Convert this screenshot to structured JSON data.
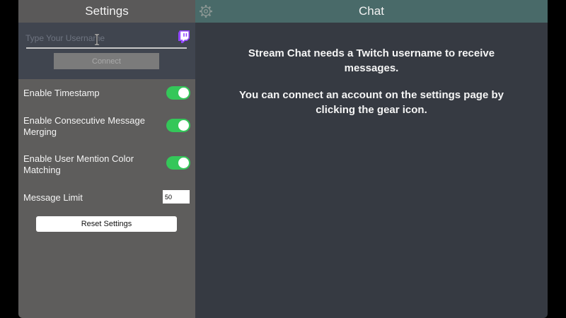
{
  "settings": {
    "title": "Settings",
    "username_placeholder": "Type Your Username",
    "username_value": "",
    "connect_label": "Connect",
    "options": [
      {
        "label": "Enable Timestamp",
        "enabled": true
      },
      {
        "label": "Enable Consecutive Message Merging",
        "enabled": true
      },
      {
        "label": "Enable User Mention Color Matching",
        "enabled": true
      }
    ],
    "message_limit_label": "Message Limit",
    "message_limit_value": "50",
    "reset_label": "Reset Settings"
  },
  "chat": {
    "title": "Chat",
    "message_line1": "Stream Chat needs a Twitch username to receive messages.",
    "message_line2": "You can connect an account on the settings page by clicking the gear icon."
  },
  "icons": {
    "gear": "gear-icon",
    "twitch": "twitch-icon",
    "cursor": "text-cursor-icon"
  },
  "colors": {
    "toggle_on": "#34c759",
    "twitch_purple": "#9146ff",
    "chat_header": "#496a69",
    "chat_background": "#363a42",
    "settings_background": "#5e5d5c"
  }
}
